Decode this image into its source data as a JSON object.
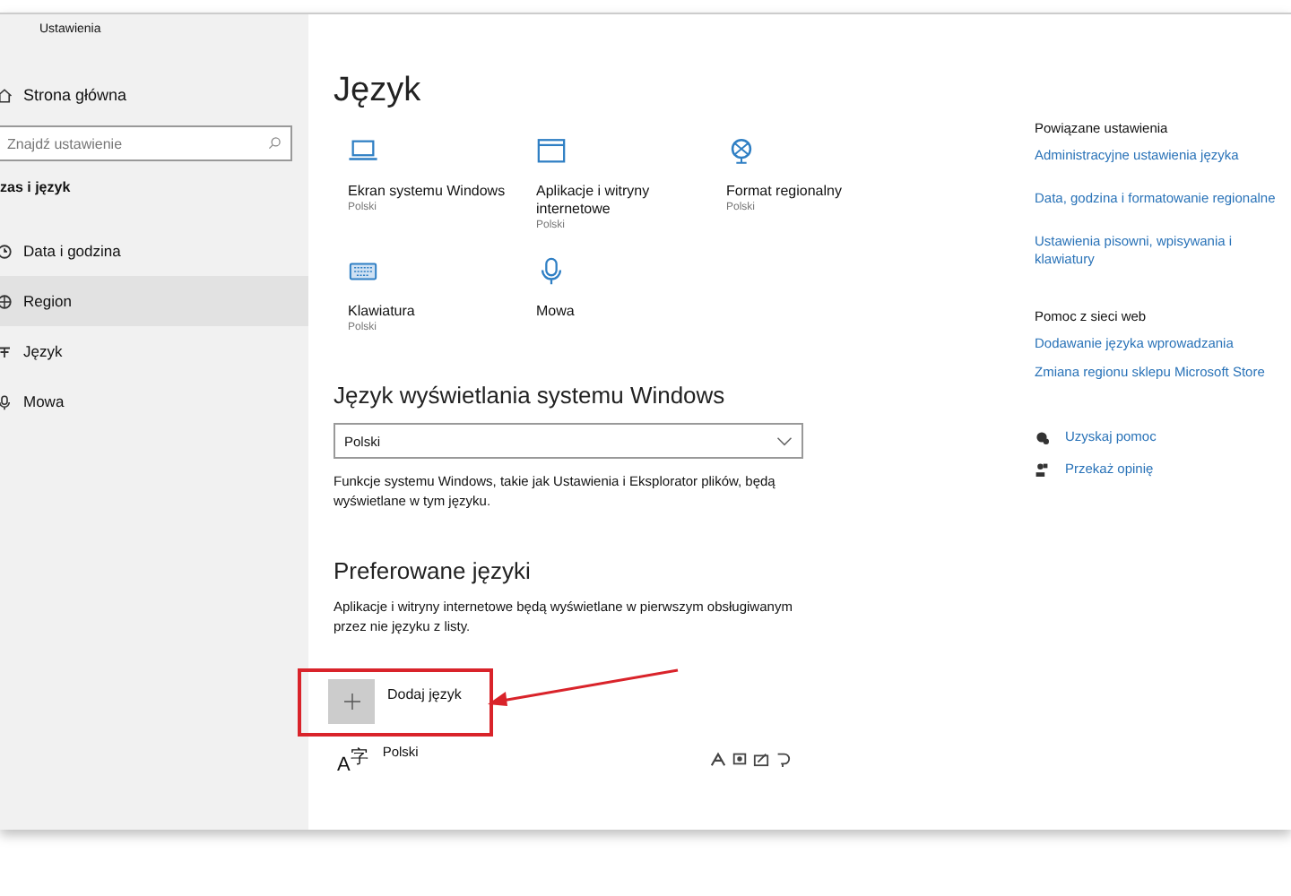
{
  "window": {
    "title": "Ustawienia"
  },
  "sidebar": {
    "home": "Strona główna",
    "search": {
      "placeholder": "Znajdź ustawienie"
    },
    "section": "zas i język",
    "items": [
      {
        "label": "Data i godzina",
        "selected": false
      },
      {
        "label": "Region",
        "selected": true
      },
      {
        "label": "Język",
        "selected": false
      },
      {
        "label": "Mowa",
        "selected": false
      }
    ]
  },
  "page": {
    "title": "Język",
    "tiles": [
      {
        "label": "Ekran systemu Windows",
        "value": "Polski"
      },
      {
        "label": "Aplikacje i witryny internetowe",
        "value": "Polski"
      },
      {
        "label": "Format regionalny",
        "value": "Polski"
      },
      {
        "label": "Klawiatura",
        "value": "Polski"
      },
      {
        "label": "Mowa"
      }
    ],
    "display_language": {
      "heading": "Język wyświetlania systemu Windows",
      "value": "Polski",
      "description": "Funkcje systemu Windows, takie jak Ustawienia i Eksplorator plików, będą wyświetlane w tym języku."
    },
    "preferred": {
      "heading": "Preferowane języki",
      "description": "Aplikacje i witryny internetowe będą wyświetlane w pierwszym obsługiwanym przez nie języku z listy.",
      "add_button": "Dodaj język",
      "languages": [
        {
          "glyph": "A$^{字}$",
          "name": "Polski"
        }
      ]
    },
    "annotation": {
      "kind": "box-arrow"
    }
  },
  "related": {
    "heading": "Powiązane ustawienia",
    "links": [
      "Administracyjne ustawienia języka",
      "Data, godzina i formatowanie regionalne",
      "Ustawienia pisowni, wpisywania i klawiatury"
    ],
    "help_heading": "Pomoc z sieci web",
    "help_links": [
      "Dodawanie języka wprowadzania",
      "Zmiana regionu sklepu Microsoft Store"
    ],
    "actions": [
      {
        "kind": "help",
        "label": "Uzyskaj pomoc"
      },
      {
        "kind": "feedback",
        "label": "Przekaż opinię"
      }
    ]
  }
}
